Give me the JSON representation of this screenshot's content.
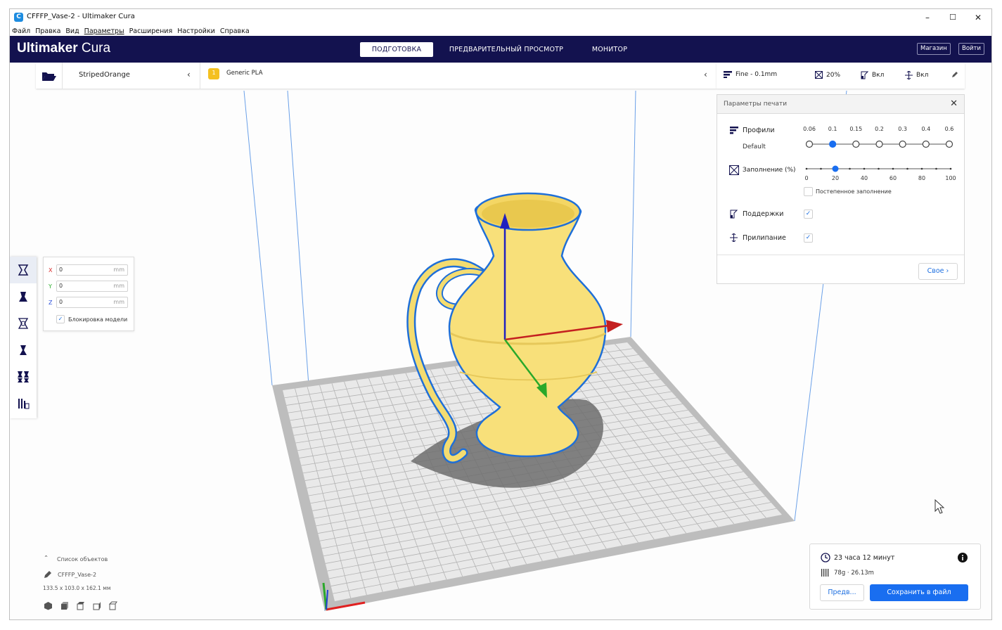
{
  "window": {
    "title": "CFFFP_Vase-2 - Ultimaker Cura",
    "minimize": "–",
    "maximize": "☐",
    "close": "✕"
  },
  "menu": [
    "Файл",
    "Правка",
    "Вид",
    "Параметры",
    "Расширения",
    "Настройки",
    "Справка"
  ],
  "header": {
    "brand_bold": "Ultimaker",
    "brand_light": "Cura",
    "tabs": [
      "ПОДГОТОВКА",
      "ПРЕДВАРИТЕЛЬНЫЙ ПРОСМОТР",
      "МОНИТОР"
    ],
    "active_tab": 0,
    "marketplace": "Магазин",
    "signin": "Войти"
  },
  "printer": {
    "name": "StripedOrange",
    "material_extruder": "1",
    "material": "Generic PLA"
  },
  "settings_summary": {
    "profile": "Fine - 0.1mm",
    "infill": "20%",
    "support": "Вкл",
    "adhesion": "Вкл",
    "icons": [
      "profile-icon",
      "infill-icon",
      "support-icon",
      "adhesion-icon",
      "pencil-icon"
    ]
  },
  "print_settings": {
    "title": "Параметры печати",
    "profiles_label": "Профили",
    "profile_name": "Default",
    "layer_heights": [
      "0.06",
      "0.1",
      "0.15",
      "0.2",
      "0.3",
      "0.4",
      "0.6"
    ],
    "selected_layer_height_index": 1,
    "infill_label": "Заполнение (%)",
    "infill_ticks": [
      "0",
      "20",
      "40",
      "60",
      "80",
      "100"
    ],
    "infill_value": 20,
    "gradual_infill": "Постепенное заполнение",
    "gradual_checked": false,
    "support_label": "Поддержки",
    "support_checked": true,
    "adhesion_label": "Прилипание",
    "adhesion_checked": true,
    "custom_button": "Свое"
  },
  "move_panel": {
    "x_label": "X",
    "x_value": "0",
    "y_label": "Y",
    "y_value": "0",
    "z_label": "Z",
    "z_value": "0",
    "unit": "mm",
    "lock_label": "Блокировка модели",
    "lock_checked": true,
    "axis_colors": {
      "x": "#d92b2b",
      "y": "#2fae2f",
      "z": "#2b4fd9"
    }
  },
  "tools": [
    "move-tool-icon",
    "scale-tool-icon",
    "rotate-tool-icon",
    "mirror-tool-icon",
    "per-model-settings-icon",
    "support-blocker-icon"
  ],
  "object_list": {
    "header": "Список объектов",
    "object_name": "CFFFP_Vase-2",
    "dimensions": "133.5 x 103.0 x 162.1 мм",
    "view_icons": [
      "3d-view-icon",
      "front-view-icon",
      "top-view-icon",
      "left-view-icon",
      "right-view-icon"
    ]
  },
  "action_panel": {
    "time": "23 часа 12 минут",
    "material_usage": "78g · 26.13m",
    "preview_button": "Предв...",
    "save_button": "Сохранить в файл"
  },
  "colors": {
    "header": "#13124f",
    "accent": "#196ef0",
    "model": "#f8e07a",
    "model_outline": "#1f6fd8"
  }
}
